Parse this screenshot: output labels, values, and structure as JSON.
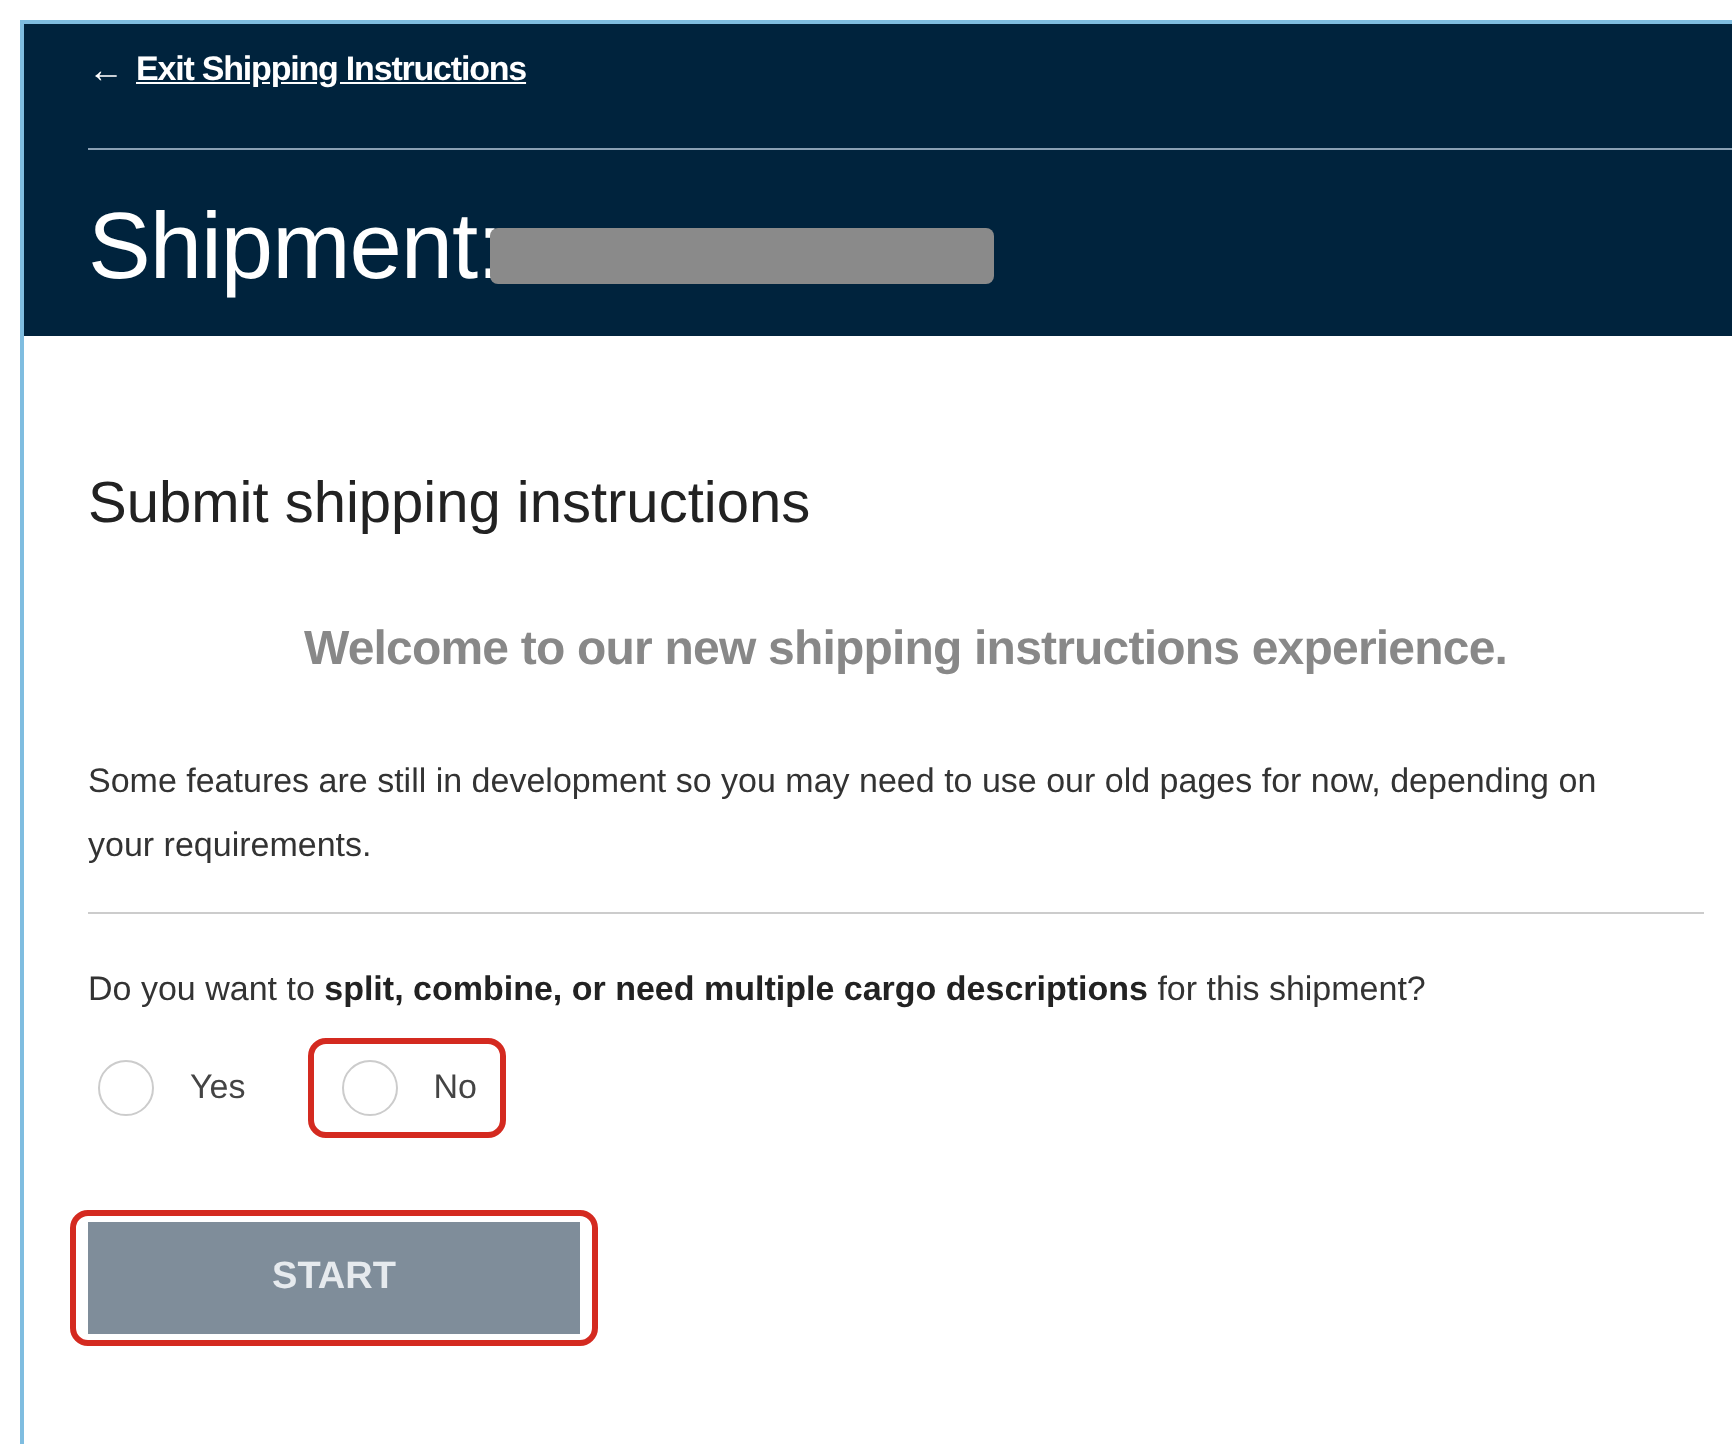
{
  "header": {
    "back_arrow": "←",
    "back_link": "Exit Shipping Instructions",
    "title": "Shipment:",
    "number_redacted": true
  },
  "section_title": "Submit shipping instructions",
  "welcome": "Welcome to our new shipping instructions experience.",
  "notice": "Some features are still in development so you may need to use our old pages for now, depending on your requirements.",
  "question": "Do you want to **split, combine, or need multiple cargo descriptions** for this shipment?",
  "options": [
    {
      "label": "Yes",
      "selected": false,
      "highlighted": false
    },
    {
      "label": "No",
      "selected": false,
      "highlighted": true
    }
  ],
  "start_button": {
    "label": "START",
    "disabled": true,
    "highlighted": true
  }
}
